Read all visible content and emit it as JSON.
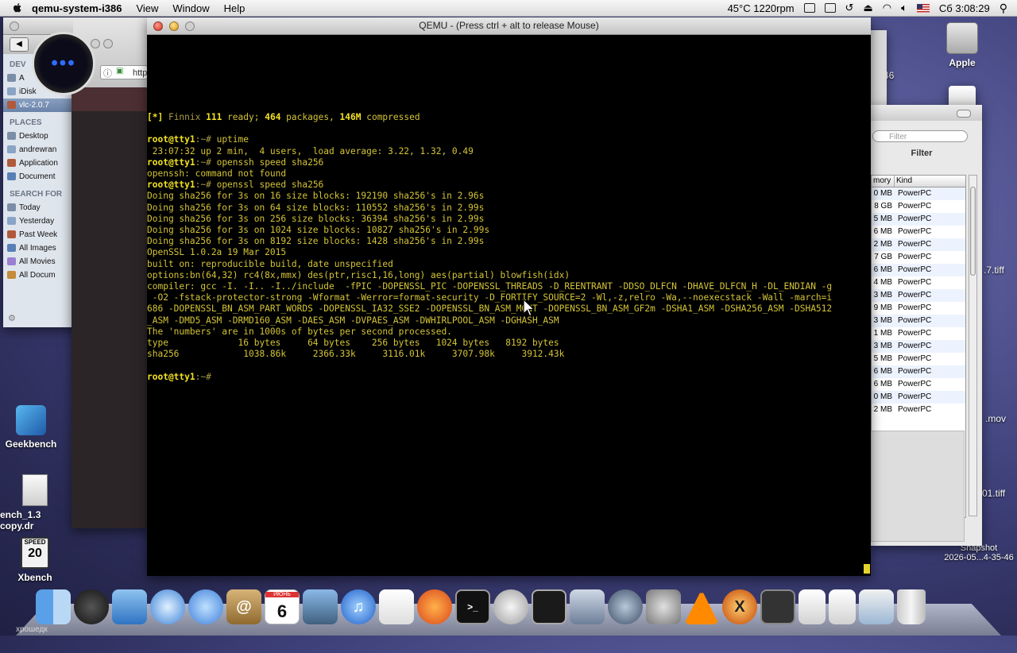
{
  "menubar": {
    "app_name": "qemu-system-i386",
    "menus": [
      "View",
      "Window",
      "Help"
    ],
    "status": "45°C 1220rpm",
    "clock": "Сб 3:08:29"
  },
  "finder_sidebar": {
    "devices_head": "DEV",
    "devices": [
      "A",
      "iDisk",
      "vlc-2.0.7"
    ],
    "places_head": "PLACES",
    "places": [
      "Desktop",
      "andrewran",
      "Application",
      "Document"
    ],
    "search_head": "SEARCH FOR",
    "search": [
      "Today",
      "Yesterday",
      "Past Week",
      "All Images",
      "All Movies",
      "All Docum"
    ]
  },
  "safari": {
    "url_fragment": "http"
  },
  "qemu": {
    "title": "QEMU - (Press ctrl + alt to release Mouse)",
    "banner_prefix": "[*] ",
    "banner_name": "Finnix ",
    "banner_ver": "111",
    "banner_ready": " ready; ",
    "banner_pkgs": "464",
    "banner_pkgs_txt": " packages, ",
    "banner_size": "146M",
    "banner_tail": " compressed",
    "prompt_user": "root@tty1",
    "prompt_tail": ":~# ",
    "cmd1": "uptime",
    "out1": " 23:07:32 up 2 min,  4 users,  load average: 3.22, 1.32, 0.49",
    "cmd2": "openssh speed sha256",
    "out2": "openssh: command not found",
    "cmd3": "openssl speed sha256",
    "out3": [
      "Doing sha256 for 3s on 16 size blocks: 192190 sha256's in 2.96s",
      "Doing sha256 for 3s on 64 size blocks: 110552 sha256's in 2.99s",
      "Doing sha256 for 3s on 256 size blocks: 36394 sha256's in 2.99s",
      "Doing sha256 for 3s on 1024 size blocks: 10827 sha256's in 2.99s",
      "Doing sha256 for 3s on 8192 size blocks: 1428 sha256's in 2.99s",
      "OpenSSL 1.0.2a 19 Mar 2015",
      "built on: reproducible build, date unspecified",
      "options:bn(64,32) rc4(8x,mmx) des(ptr,risc1,16,long) aes(partial) blowfish(idx)",
      "compiler: gcc -I. -I.. -I../include  -fPIC -DOPENSSL_PIC -DOPENSSL_THREADS -D_REENTRANT -DDSO_DLFCN -DHAVE_DLFCN_H -DL_ENDIAN -g",
      " -O2 -fstack-protector-strong -Wformat -Werror=format-security -D_FORTIFY_SOURCE=2 -Wl,-z,relro -Wa,--noexecstack -Wall -march=i",
      "686 -DOPENSSL_BN_ASM_PART_WORDS -DOPENSSL_IA32_SSE2 -DOPENSSL_BN_ASM_MONT -DOPENSSL_BN_ASM_GF2m -DSHA1_ASM -DSHA256_ASM -DSHA512",
      "_ASM -DMD5_ASM -DRMD160_ASM -DAES_ASM -DVPAES_ASM -DWHIRLPOOL_ASM -DGHASH_ASM",
      "The 'numbers' are in 1000s of bytes per second processed.",
      "type             16 bytes     64 bytes    256 bytes   1024 bytes   8192 bytes",
      "sha256            1038.86k     2366.33k     3116.01k     3707.98k     3912.43k"
    ]
  },
  "right_window": {
    "filter_placeholder": "Filter",
    "filter_label": "Filter",
    "col_memory": "mory",
    "col_kind": "Kind",
    "rows": [
      [
        "0 MB",
        "PowerPC"
      ],
      [
        "8 GB",
        "PowerPC"
      ],
      [
        "5 MB",
        "PowerPC"
      ],
      [
        "6 MB",
        "PowerPC"
      ],
      [
        "2 MB",
        "PowerPC"
      ],
      [
        "7 GB",
        "PowerPC"
      ],
      [
        "6 MB",
        "PowerPC"
      ],
      [
        "4 MB",
        "PowerPC"
      ],
      [
        "3 MB",
        "PowerPC"
      ],
      [
        "9 MB",
        "PowerPC"
      ],
      [
        "3 MB",
        "PowerPC"
      ],
      [
        "1 MB",
        "PowerPC"
      ],
      [
        "3 MB",
        "PowerPC"
      ],
      [
        "5 MB",
        "PowerPC"
      ],
      [
        "6 MB",
        "PowerPC"
      ],
      [
        "6 MB",
        "PowerPC"
      ],
      [
        "0 MB",
        "PowerPC"
      ],
      [
        "2 MB",
        "PowerPC"
      ]
    ]
  },
  "desktop": {
    "apple_hd": "Apple",
    "geekbench": "Geekbench",
    "bench_copy": "ench_1.3 copy.dr",
    "xbench": "Xbench",
    "xbench_badge_top": "SPEED",
    "xbench_badge_num": "20",
    "snapshot_name": "Snapshot",
    "snapshot_date": "2026-05...4-35-46",
    "edge_46": "46",
    "edge_tiff1": ".7.tiff",
    "edge_mov": ".mov",
    "edge_tiff2": "01.tiff"
  },
  "dock": {
    "bottom_label": "хрошедк",
    "calendar_day": "6",
    "calendar_month": "ИЮНЬ"
  },
  "colors": {
    "terminal_bg": "#000000",
    "terminal_fg": "#d4c436",
    "prompt": "#f2e224"
  }
}
